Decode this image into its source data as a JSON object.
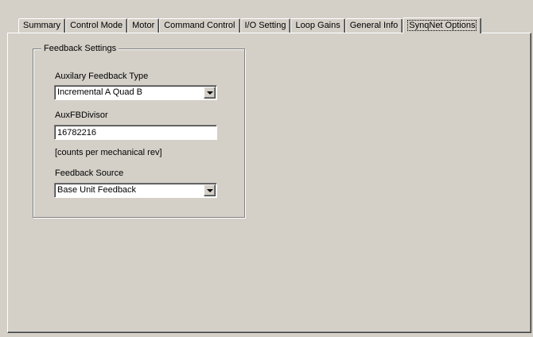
{
  "tabs": [
    {
      "label": "Summary"
    },
    {
      "label": "Control Mode"
    },
    {
      "label": "Motor"
    },
    {
      "label": "Command Control"
    },
    {
      "label": "I/O Setting"
    },
    {
      "label": "Loop Gains"
    },
    {
      "label": "General Info"
    },
    {
      "label": "SynqNet Options"
    }
  ],
  "active_tab": "SynqNet Options",
  "feedback_settings": {
    "title": "Feedback Settings",
    "aux_feedback_type": {
      "label": "Auxilary Feedback Type",
      "value": "Incremental A Quad B"
    },
    "aux_fb_divisor": {
      "label": "AuxFBDivisor",
      "value": "16782216",
      "units": "[counts per mechanical rev]"
    },
    "feedback_source": {
      "label": "Feedback Source",
      "value": "Base Unit Feedback"
    }
  }
}
